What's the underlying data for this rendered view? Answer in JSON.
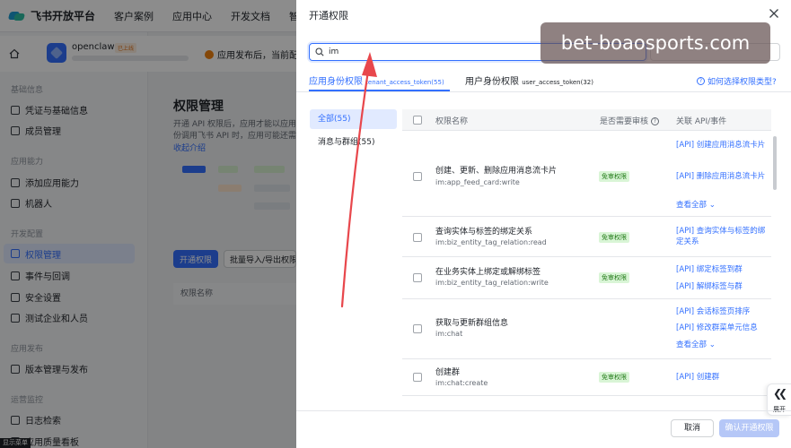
{
  "topnav": {
    "brand": "飞书开放平台",
    "items": [
      "客户案例",
      "应用中心",
      "开发文档",
      "智能助"
    ]
  },
  "app": {
    "name": "openclaw",
    "status": "已上线",
    "notice": "应用发布后，当前配置"
  },
  "sidebar": {
    "groups": [
      {
        "title": "基础信息",
        "items": [
          "凭证与基础信息",
          "成员管理"
        ]
      },
      {
        "title": "应用能力",
        "items": [
          "添加应用能力",
          "机器人"
        ]
      },
      {
        "title": "开发配置",
        "items": [
          "权限管理",
          "事件与回调",
          "安全设置",
          "测试企业和人员"
        ]
      },
      {
        "title": "应用发布",
        "items": [
          "版本管理与发布"
        ]
      },
      {
        "title": "运营监控",
        "items": [
          "日志检索",
          "应用质量看板"
        ]
      }
    ],
    "bottom_chip": "显示菜单"
  },
  "main": {
    "title": "权限管理",
    "desc_line1": "开通 API 权限后，应用才能以应用",
    "desc_line2": "份调用飞书 API 时，应用可能还需要",
    "collapse_link": "收起介绍",
    "primary_button": "开通权限",
    "secondary_button": "批量导入/导出权限",
    "column_header": "权限名称"
  },
  "drawer": {
    "title": "开通权限",
    "search": {
      "value": "im",
      "placeholder": ""
    },
    "tabs": [
      {
        "label": "应用身份权限",
        "sub": "tenant_access_token(55)",
        "active": true
      },
      {
        "label": "用户身份权限",
        "sub": "user_access_token(32)",
        "active": false
      }
    ],
    "help_link": "如何选择权限类型?",
    "categories": [
      "全部(55)",
      "消息与群组(55)"
    ],
    "table": {
      "headers": {
        "name": "权限名称",
        "review": "是否需要审核",
        "api": "关联 API/事件"
      },
      "rows": [
        {
          "name": "创建、更新、删除应用消息流卡片",
          "code": "im:app_feed_card:write",
          "review": "免审权限",
          "apis": [
            "[API] 创建应用消息流卡片",
            "[API] 删除应用消息流卡片"
          ],
          "more": "查看全部"
        },
        {
          "name": "查询实体与标签的绑定关系",
          "code": "im:biz_entity_tag_relation:read",
          "review": "免审权限",
          "apis": [
            "[API] 查询实体与标签的绑定关系"
          ],
          "more": ""
        },
        {
          "name": "在业务实体上绑定或解绑标签",
          "code": "im:biz_entity_tag_relation:write",
          "review": "免审权限",
          "apis": [
            "[API] 绑定标签到群",
            "[API] 解绑标签与群"
          ],
          "more": ""
        },
        {
          "name": "获取与更新群组信息",
          "code": "im:chat",
          "review": "",
          "apis": [
            "[API] 会话标签页排序",
            "[API] 修改群菜单元信息"
          ],
          "more": "查看全部"
        },
        {
          "name": "创建群",
          "code": "im:chat:create",
          "review": "免审权限",
          "apis": [
            "[API] 创建群"
          ],
          "more": ""
        }
      ]
    },
    "expand_label": "展开",
    "cancel": "取消",
    "confirm": "确认开通权限"
  },
  "watermark": "bet-boaosports.com",
  "colors": {
    "accent": "#3370ff",
    "arrow": "#e8474c",
    "badge_bg": "#d9f5d6",
    "badge_text": "#237b19"
  }
}
